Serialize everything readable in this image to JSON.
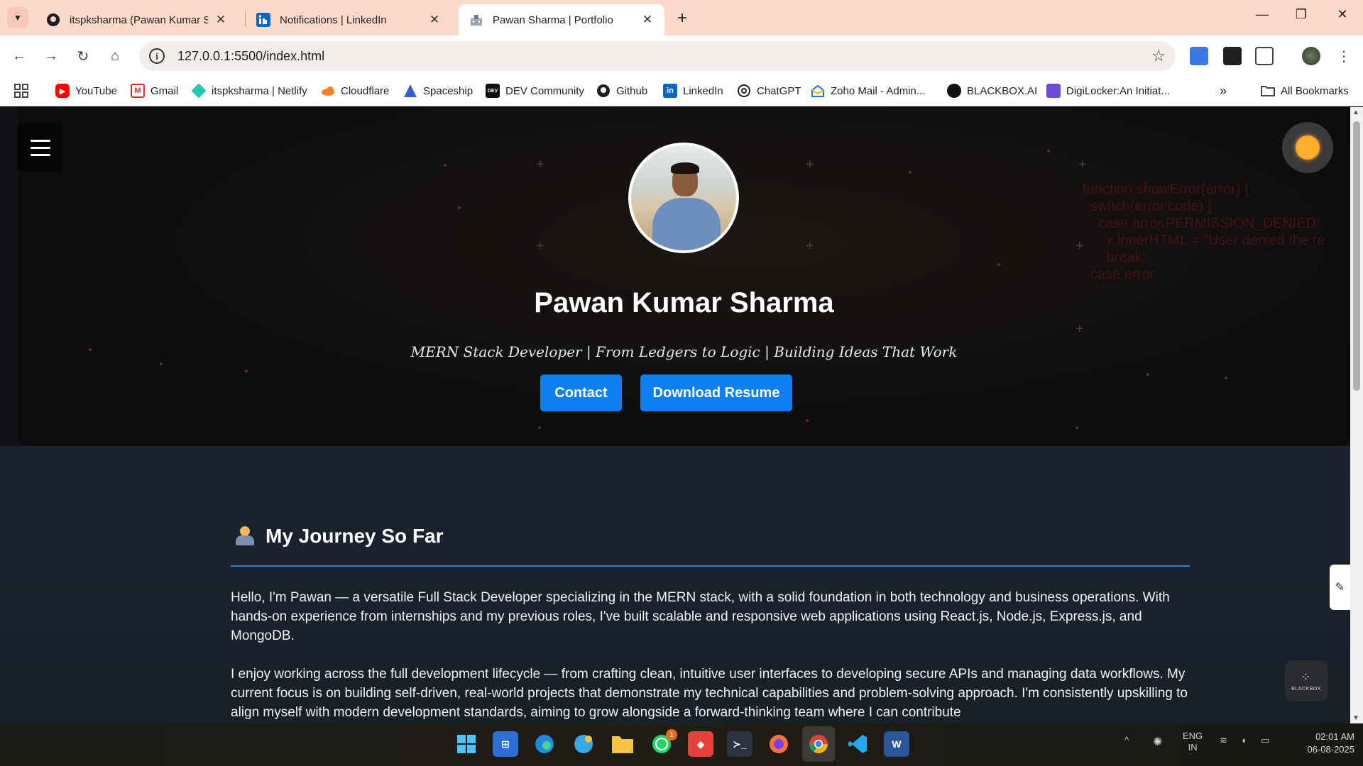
{
  "browser": {
    "tabs": [
      {
        "title": "itspksharma (Pawan Kumar Sha"
      },
      {
        "title": "Notifications | LinkedIn"
      },
      {
        "title": "Pawan Sharma | Portfolio"
      }
    ],
    "url": "127.0.0.1:5500/index.html",
    "bookmarks": [
      {
        "label": "YouTube"
      },
      {
        "label": "Gmail"
      },
      {
        "label": "itspksharma | Netlify"
      },
      {
        "label": "Cloudflare"
      },
      {
        "label": "Spaceship"
      },
      {
        "label": "DEV Community"
      },
      {
        "label": "Github"
      },
      {
        "label": "LinkedIn"
      },
      {
        "label": "ChatGPT"
      },
      {
        "label": "Zoho Mail - Admin..."
      },
      {
        "label": "BLACKBOX.AI"
      },
      {
        "label": "DigiLocker:An Initiat..."
      }
    ],
    "all_bookmarks": "All Bookmarks",
    "bm_icon_text": {
      "dev": "DEV",
      "linkedin": "in"
    }
  },
  "hero": {
    "name": "Pawan Kumar Sharma",
    "tagline": "MERN Stack Developer | From Ledgers to Logic | Building Ideas That Work",
    "contact_label": "Contact",
    "resume_label": "Download Resume",
    "code_lines": "function showError(error) {\n  switch(error.code) {\n    case error.PERMISSION_DENIED:\n      x.innerHTML = \"User denied the re\n      break;\n  case error"
  },
  "about": {
    "title": "My Journey So Far",
    "paragraphs": [
      "Hello, I'm Pawan — a versatile Full Stack Developer specializing in the MERN stack, with a solid foundation in both technology and business operations. With hands-on experience from internships and my previous roles, I've built scalable and responsive web applications using React.js, Node.js, Express.js, and MongoDB.",
      "I enjoy working across the full development lifecycle — from crafting clean, intuitive user interfaces to developing secure APIs and managing data workflows. My current focus is on building self-driven, real-world projects that demonstrate my technical capabilities and problem-solving approach. I'm consistently upskilling to align myself with modern development standards, aiming to grow alongside a forward-thinking team where I can contribute"
    ]
  },
  "widgets": {
    "blackbox_label": "BLACKBOX"
  },
  "taskbar": {
    "whatsapp_badge": "1",
    "lang": "ENG",
    "region": "IN",
    "time": "02:01 AM",
    "date": "06-08-2025"
  },
  "colors": {
    "accent": "#0d7ff2",
    "rule": "#2d7fe0",
    "tab_strip": "#fcd9cb"
  }
}
